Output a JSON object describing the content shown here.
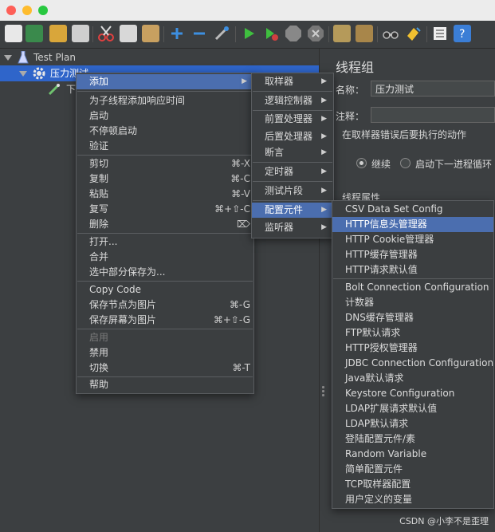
{
  "tree": {
    "test_plan": "Test Plan",
    "thread_group": "压力测试",
    "child_partial": "下"
  },
  "right_panel": {
    "title": "线程组",
    "name_label": "名称：",
    "name_value": "压力测试",
    "comment_label": "注释：",
    "error_action_label": "在取样器错误后要执行的动作",
    "radio_continue": "继续",
    "radio_next_loop": "启动下一进程循环",
    "thread_props_label": "线程属性"
  },
  "context_menu": {
    "add": "添加",
    "add_think_time": "为子线程添加响应时间",
    "start": "启动",
    "start_no_pause": "不停顿启动",
    "validate": "验证",
    "cut": "剪切",
    "cut_sc": "⌘-X",
    "copy": "复制",
    "copy_sc": "⌘-C",
    "paste": "粘贴",
    "paste_sc": "⌘-V",
    "duplicate": "复写",
    "duplicate_sc": "⌘+⇧-C",
    "delete": "删除",
    "delete_sc": "⌦",
    "open": "打开...",
    "merge": "合并",
    "save_selection": "选中部分保存为...",
    "copy_code": "Copy Code",
    "save_node_image": "保存节点为图片",
    "save_node_image_sc": "⌘-G",
    "save_screen_image": "保存屏幕为图片",
    "save_screen_image_sc": "⌘+⇧-G",
    "enable": "启用",
    "disable": "禁用",
    "toggle": "切换",
    "toggle_sc": "⌘-T",
    "help": "帮助"
  },
  "add_submenu": {
    "sampler": "取样器",
    "logic_controller": "逻辑控制器",
    "pre_processor": "前置处理器",
    "post_processor": "后置处理器",
    "assertion": "断言",
    "timer": "定时器",
    "test_fragment": "测试片段",
    "config_element": "配置元件",
    "listener": "监听器"
  },
  "config_submenu": {
    "items": [
      "CSV Data Set Config",
      "HTTP信息头管理器",
      "HTTP Cookie管理器",
      "HTTP缓存管理器",
      "HTTP请求默认值",
      "Bolt Connection Configuration",
      "计数器",
      "DNS缓存管理器",
      "FTP默认请求",
      "HTTP授权管理器",
      "JDBC Connection Configuration",
      "Java默认请求",
      "Keystore Configuration",
      "LDAP扩展请求默认值",
      "LDAP默认请求",
      "登陆配置元件/素",
      "Random Variable",
      "简单配置元件",
      "TCP取样器配置",
      "用户定义的变量"
    ]
  },
  "watermark": "CSDN @小李不是歪理",
  "colors": {
    "background": "#3c3f41",
    "selection": "#2f65ca",
    "menu_highlight": "#4b6eaf"
  }
}
